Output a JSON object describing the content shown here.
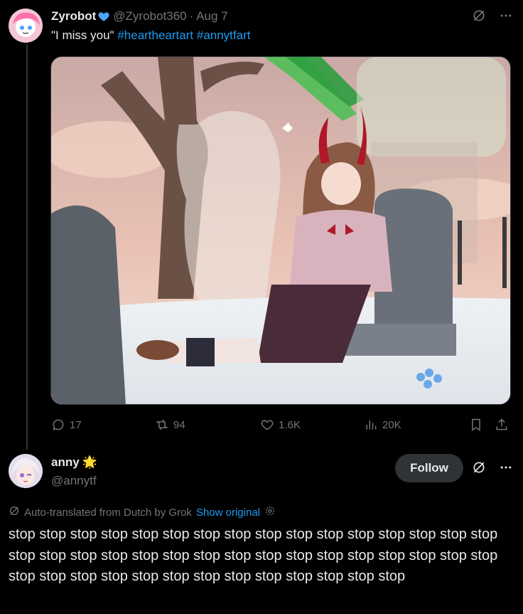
{
  "post1": {
    "name": "Zyrobot",
    "handle": "@Zyrobot360",
    "separator": "·",
    "date": "Aug 7",
    "text_quote": "\"I miss you\"",
    "hashtags": [
      "#heartheartart",
      "#annytfart"
    ],
    "media_icon": "illustration-image",
    "actions": {
      "replies": "17",
      "reposts": "94",
      "likes": "1.6K",
      "views": "20K"
    }
  },
  "post2": {
    "name": "anny",
    "badge": "🌟",
    "handle": "@annytf",
    "follow_label": "Follow",
    "translation_note": "Auto-translated from Dutch by Grok",
    "show_original": "Show original",
    "body": "stop stop stop stop stop stop stop stop stop stop stop stop stop stop stop stop stop stop stop stop stop stop stop stop stop stop stop stop stop stop stop stop stop stop stop stop stop stop stop stop stop stop stop stop stop"
  },
  "colors": {
    "background": "#000000",
    "text": "#e7e9ea",
    "muted": "#71767b",
    "link": "#1d9bf0",
    "follow_bg": "#2f3336"
  }
}
